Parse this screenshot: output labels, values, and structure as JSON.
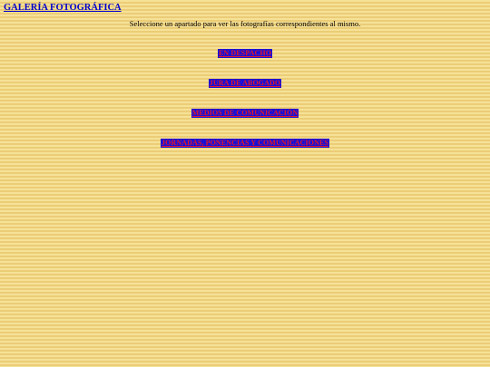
{
  "header": {
    "title": "GALERÍA FOTOGRÁFICA",
    "instructions": "Seleccione un apartado para ver las fotografías correspondientes al mismo."
  },
  "sections": [
    {
      "label": "EN DESPACHO"
    },
    {
      "label": "JURA DE ABOGADO"
    },
    {
      "label": "MEDIOS DE COMUNICACIÓN"
    },
    {
      "label": "JORNADAS, PONENCIAS Y COMUNICACIONES"
    }
  ],
  "colors": {
    "background": "#f3db8a",
    "link_background": "#1a10d4",
    "link_text": "#e0182a",
    "title_link": "#0000cc"
  }
}
